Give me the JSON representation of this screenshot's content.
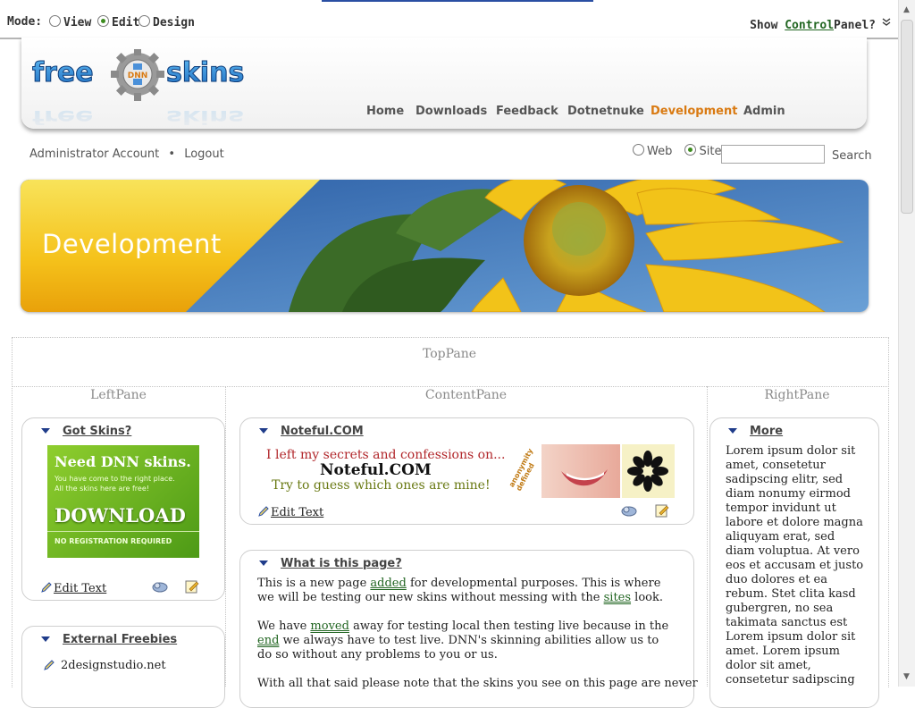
{
  "control_panel": {
    "mode_label": "Mode:",
    "modes": [
      {
        "label": "View",
        "checked": false
      },
      {
        "label": "Edit",
        "checked": true
      },
      {
        "label": "Design",
        "checked": false
      }
    ],
    "show_label_pre": "Show",
    "show_link": "Control",
    "show_label_post": "Panel?"
  },
  "logo": {
    "text": "free skins",
    "badge": "DNN"
  },
  "nav": [
    "Home",
    "Downloads",
    "Feedback",
    "Dotnetnuke",
    "Development",
    "Admin"
  ],
  "nav_active": "Development",
  "user": {
    "account": "Administrator Account",
    "separator": "•",
    "logout": "Logout"
  },
  "search": {
    "web_label": "Web",
    "site_label": "Site",
    "value": "",
    "button": "Search"
  },
  "banner": {
    "title": "Development"
  },
  "panes": {
    "top": "TopPane",
    "left": "LeftPane",
    "content": "ContentPane",
    "right": "RightPane"
  },
  "left": {
    "got_skins": {
      "title": "Got Skins?",
      "ad_title": "Need DNN skins.",
      "ad_line1": "You have come to the right place.",
      "ad_line2": "All the skins here are free!",
      "ad_download": "DOWNLOAD",
      "ad_footer": "NO REGISTRATION REQUIRED",
      "edit": "Edit Text"
    },
    "freebies": {
      "title": "External Freebies",
      "items": [
        "2designstudio.net"
      ]
    }
  },
  "content": {
    "noteful": {
      "title": "Noteful.COM",
      "line1": "I left my secrets and confessions on...",
      "brand": "Noteful.COM",
      "line2": "Try to guess which ones are mine!",
      "stamp": "anonymity defined",
      "edit": "Edit Text"
    },
    "what": {
      "title": "What is this page?",
      "p1_a": "This is a new page ",
      "p1_link1": "added",
      "p1_b": " for developmental purposes. This is where we will be testing our new skins without messing with the ",
      "p1_link2": "sites",
      "p1_c": " look.",
      "p2_a": "We have ",
      "p2_link1": "moved",
      "p2_b": " away for testing local then testing live because in the ",
      "p2_link2": "end",
      "p2_c": " we always have to test live. DNN's skinning abilities allow us to do so without any problems to you or us.",
      "p3": "With all that said please note that the skins you see on this page are never"
    }
  },
  "right": {
    "more": {
      "title": "More",
      "text": "Lorem ipsum dolor sit amet, consetetur sadipscing elitr, sed diam nonumy eirmod tempor invidunt ut labore et dolore magna aliquyam erat, sed diam voluptua. At vero eos et accusam et justo duo dolores et ea rebum. Stet clita kasd gubergren, no sea takimata sanctus est Lorem ipsum dolor sit amet. Lorem ipsum dolor sit amet, consetetur sadipscing"
    }
  },
  "colors": {
    "accent": "#d97a12",
    "link_green": "#226622",
    "banner_yellow": "#f5c21b",
    "sky_blue": "#3b6fb0"
  }
}
